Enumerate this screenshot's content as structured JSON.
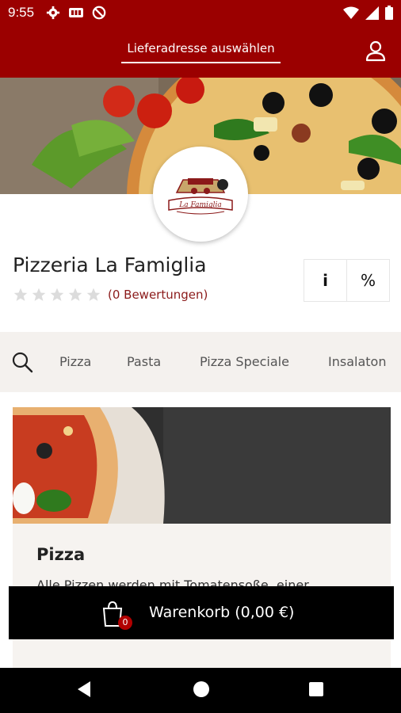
{
  "status": {
    "time": "9:55"
  },
  "header": {
    "address_label": "Lieferadresse auswählen"
  },
  "restaurant": {
    "name": "Pizzeria La Famiglia",
    "reviews": "(0 Bewertungen)",
    "rating": 0,
    "rating_max": 5,
    "info_label": "i",
    "discount_label": "%",
    "logo_text": "La Famiglia"
  },
  "categories": [
    "Pizza",
    "Pasta",
    "Pizza Speciale",
    "Insalaton"
  ],
  "section": {
    "title": "Pizza",
    "description": "Alle Pizzen werden mit Tomatensoße, einer ... kalabresischem Oregano verfeinert. Da unser Pizzateig von Hand geknetet und ohne"
  },
  "cart": {
    "label": "Warenkorb (0,00 €)",
    "count": "0"
  },
  "colors": {
    "brand": "#9b0000",
    "card_bg": "#f6f3f0",
    "cat_bg": "#f4f1ee"
  }
}
